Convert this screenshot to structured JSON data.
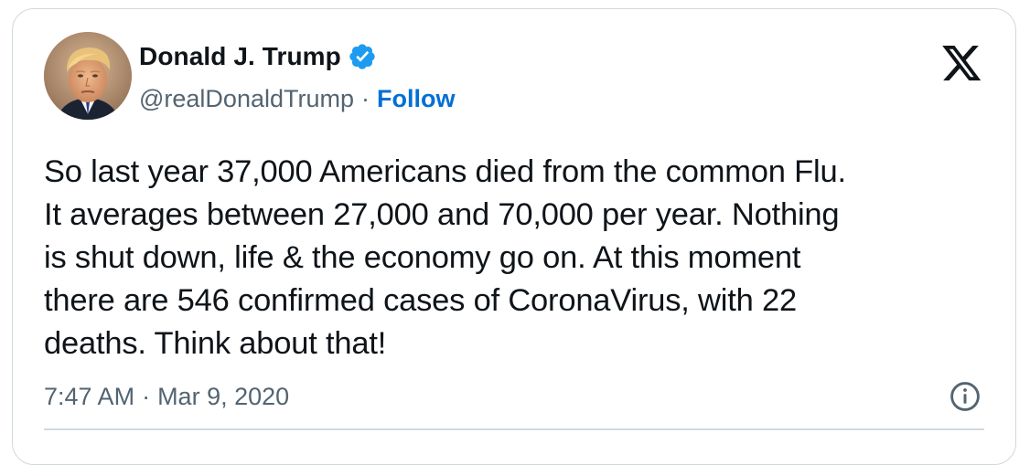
{
  "author": {
    "display_name": "Donald J. Trump",
    "handle": "@realDonaldTrump",
    "verified": true,
    "verified_color": "#1d9bf0",
    "avatar_icon": "profile-photo"
  },
  "header": {
    "separator": "·",
    "follow_label": "Follow",
    "follow_color": "#006fd6",
    "close_icon": "x-logo-icon"
  },
  "tweet": {
    "text": "So last year 37,000 Americans died from the common Flu.\nIt averages between 27,000 and 70,000 per year. Nothing\nis shut down, life & the economy go on. At this moment\nthere are 546 confirmed cases of CoronaVirus, with 22\ndeaths. Think about that!"
  },
  "meta": {
    "time": "7:47 AM",
    "separator": "·",
    "date": "Mar 9, 2020",
    "info_icon": "info-icon"
  }
}
